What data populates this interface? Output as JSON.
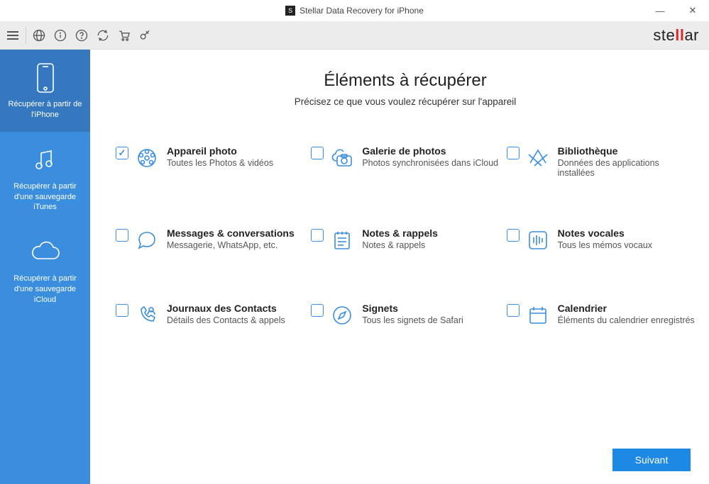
{
  "window": {
    "title": "Stellar Data Recovery for iPhone"
  },
  "brand": {
    "pre": "ste",
    "accent": "ll",
    "post": "ar"
  },
  "sidebar": {
    "items": [
      {
        "label": "Récupérer à partir de l'iPhone"
      },
      {
        "label": "Récupérer à partir d'une sauvegarde iTunes"
      },
      {
        "label": "Récupérer à partir d'une sauvegarde iCloud"
      }
    ]
  },
  "main": {
    "title": "Éléments à récupérer",
    "subtitle": "Précisez ce que vous voulez récupérer sur l'appareil",
    "next_label": "Suivant",
    "items": [
      {
        "title": "Appareil photo",
        "desc": "Toutes les Photos & vidéos",
        "checked": true
      },
      {
        "title": "Galerie de photos",
        "desc": "Photos synchronisées dans iCloud",
        "checked": false
      },
      {
        "title": "Bibliothèque",
        "desc": "Données des applications installées",
        "checked": false
      },
      {
        "title": "Messages & conversations",
        "desc": "Messagerie, WhatsApp, etc.",
        "checked": false
      },
      {
        "title": "Notes & rappels",
        "desc": "Notes & rappels",
        "checked": false
      },
      {
        "title": "Notes vocales",
        "desc": "Tous les mémos vocaux",
        "checked": false
      },
      {
        "title": "Journaux des Contacts",
        "desc": "Détails des Contacts & appels",
        "checked": false
      },
      {
        "title": "Signets",
        "desc": "Tous les signets de Safari",
        "checked": false
      },
      {
        "title": "Calendrier",
        "desc": "Éléments du calendrier enregistrés",
        "checked": false
      }
    ]
  }
}
